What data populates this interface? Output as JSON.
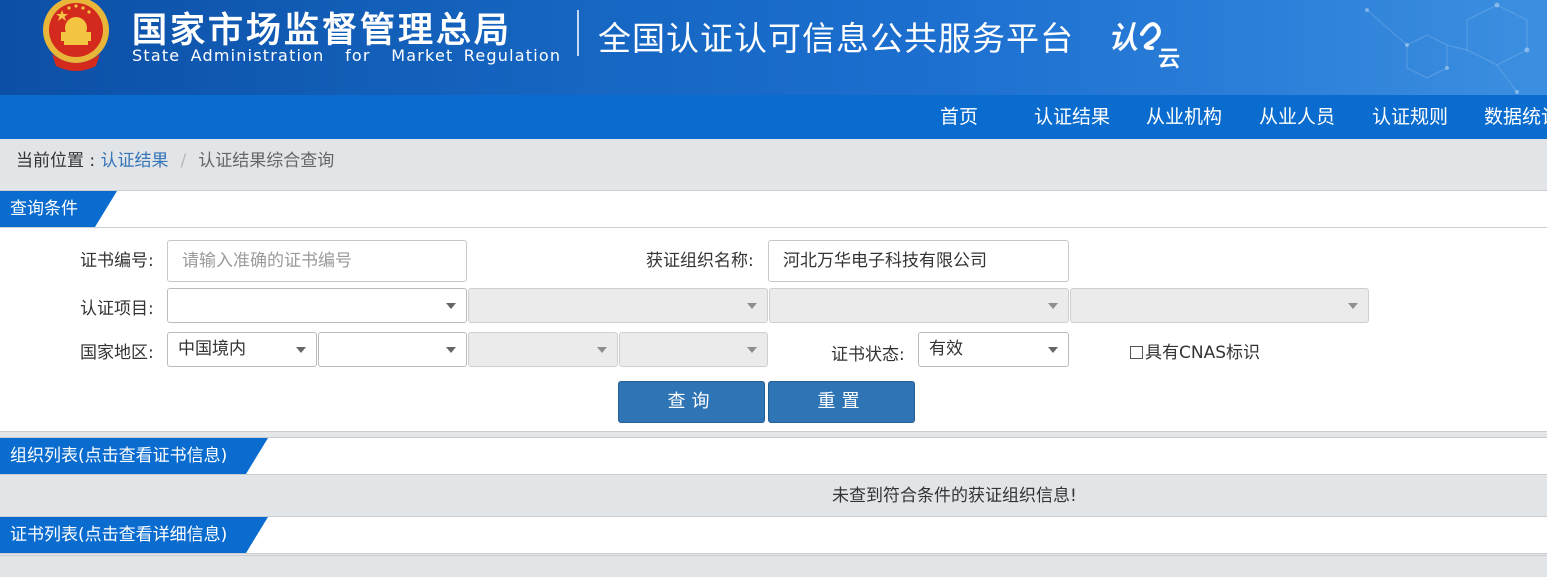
{
  "header": {
    "org_name_cn": "国家市场监督管理总局",
    "org_name_en": "State Administration  for  Market Regulation",
    "platform_title": "全国认证认可信息公共服务平台",
    "platform_logo_text": "认云"
  },
  "nav": {
    "items": [
      {
        "label": "首页"
      },
      {
        "label": "认证结果"
      },
      {
        "label": "从业机构"
      },
      {
        "label": "从业人员"
      },
      {
        "label": "认证规则"
      },
      {
        "label": "数据统计"
      }
    ]
  },
  "breadcrumb": {
    "prefix": "当前位置 : ",
    "link": "认证结果",
    "separator": "/",
    "current": "认证结果综合查询"
  },
  "query": {
    "section_title": "查询条件",
    "cert_no_label": "证书编号:",
    "cert_no_placeholder": "请输入准确的证书编号",
    "cert_no_value": "",
    "org_name_label": "获证组织名称:",
    "org_name_value": "河北万华电子科技有限公司",
    "project_label": "认证项目:",
    "project_selects": [
      "",
      "",
      "",
      ""
    ],
    "region_label": "国家地区:",
    "region_selects": [
      "中国境内",
      "",
      "",
      ""
    ],
    "status_label": "证书状态:",
    "status_value": "有效",
    "cnas_label": "具有CNAS标识",
    "cnas_checked": false,
    "search_button": "查询",
    "reset_button": "重置"
  },
  "org_list": {
    "section_title": "组织列表(点击查看证书信息)",
    "empty_message": "未查到符合条件的获证组织信息!"
  },
  "cert_list": {
    "section_title": "证书列表(点击查看详细信息)"
  },
  "colors": {
    "banner_blue": "#1565c0",
    "nav_blue": "#0a6ccf",
    "button_blue": "#2f74b5",
    "link_blue": "#3575b8"
  }
}
